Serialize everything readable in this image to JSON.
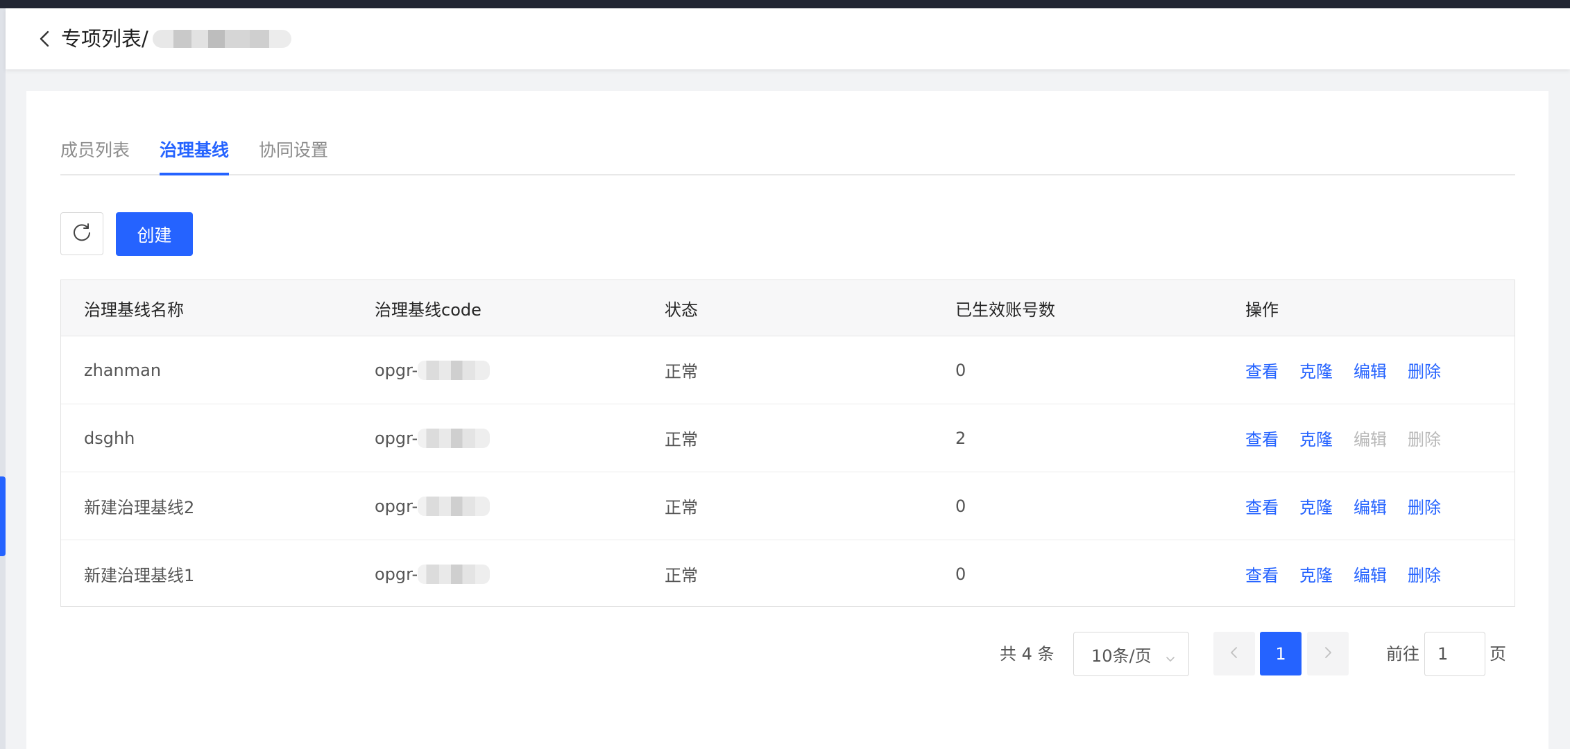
{
  "header": {
    "breadcrumb_text": "专项列表/"
  },
  "tabs": [
    {
      "label": "成员列表",
      "active": false
    },
    {
      "label": "治理基线",
      "active": true
    },
    {
      "label": "协同设置",
      "active": false
    }
  ],
  "toolbar": {
    "create_label": "创建"
  },
  "table": {
    "columns": [
      "治理基线名称",
      "治理基线code",
      "状态",
      "已生效账号数",
      "操作"
    ],
    "rows": [
      {
        "name": "zhanman",
        "code_prefix": "opgr-",
        "status": "正常",
        "count": "0",
        "actions": {
          "view": "查看",
          "clone": "克隆",
          "edit": "编辑",
          "delete": "删除"
        },
        "edit_disabled": false,
        "delete_disabled": false
      },
      {
        "name": "dsghh",
        "code_prefix": "opgr-",
        "status": "正常",
        "count": "2",
        "actions": {
          "view": "查看",
          "clone": "克隆",
          "edit": "编辑",
          "delete": "删除"
        },
        "edit_disabled": true,
        "delete_disabled": true
      },
      {
        "name": "新建治理基线2",
        "code_prefix": "opgr-",
        "status": "正常",
        "count": "0",
        "actions": {
          "view": "查看",
          "clone": "克隆",
          "edit": "编辑",
          "delete": "删除"
        },
        "edit_disabled": false,
        "delete_disabled": false
      },
      {
        "name": "新建治理基线1",
        "code_prefix": "opgr-",
        "status": "正常",
        "count": "0",
        "actions": {
          "view": "查看",
          "clone": "克隆",
          "edit": "编辑",
          "delete": "删除"
        },
        "edit_disabled": false,
        "delete_disabled": false
      }
    ]
  },
  "pagination": {
    "total_text": "共 4 条",
    "page_size": "10条/页",
    "current_page": "1",
    "goto_label": "前往",
    "goto_value": "1",
    "page_suffix": "页"
  },
  "colors": {
    "accent": "#2563ff",
    "disabled": "#b8b8b8"
  },
  "icons": [
    "back-icon",
    "refresh-icon",
    "chevron-down-icon",
    "prev-page-icon",
    "next-page-icon"
  ]
}
